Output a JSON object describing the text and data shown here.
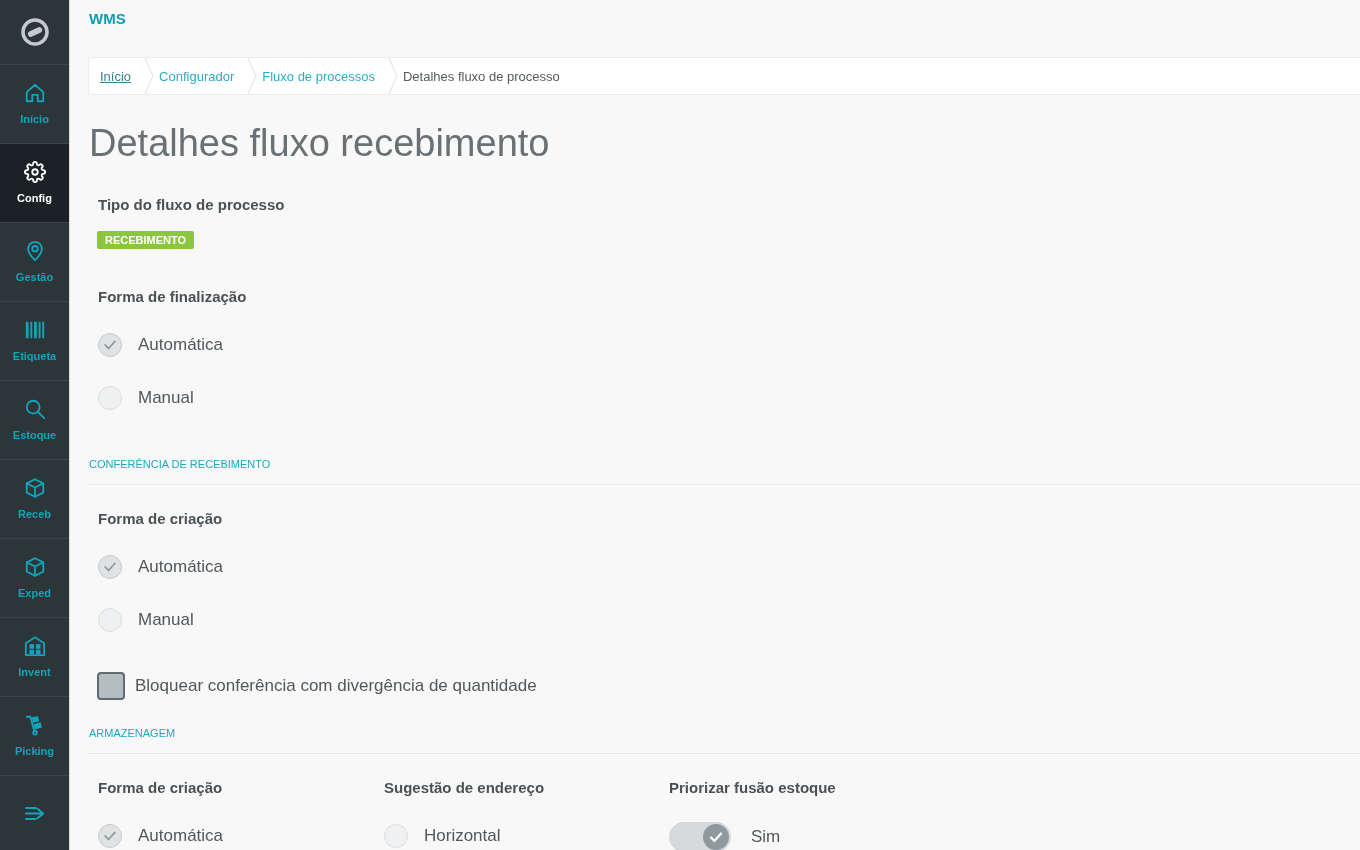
{
  "app": {
    "title": "WMS"
  },
  "sidebar": {
    "items": [
      {
        "label": "Início",
        "selected": false
      },
      {
        "label": "Config",
        "selected": true
      },
      {
        "label": "Gestão",
        "selected": false
      },
      {
        "label": "Etiqueta",
        "selected": false
      },
      {
        "label": "Estoque",
        "selected": false
      },
      {
        "label": "Receb",
        "selected": false
      },
      {
        "label": "Exped",
        "selected": false
      },
      {
        "label": "Invent",
        "selected": false
      },
      {
        "label": "Picking",
        "selected": false
      }
    ]
  },
  "breadcrumb": [
    {
      "kind": "link",
      "label": "Início",
      "underlined": true
    },
    {
      "kind": "link",
      "label": "Configurador",
      "underlined": false
    },
    {
      "kind": "link",
      "label": "Fluxo de processos",
      "underlined": false
    },
    {
      "kind": "current",
      "label": "Detalhes fluxo de processo"
    }
  ],
  "page_title": "Detalhes fluxo recebimento",
  "form": {
    "groups": [
      {
        "kind": "tag",
        "label": "Tipo do fluxo de processo",
        "value": "RECEBIMENTO"
      },
      {
        "kind": "radio",
        "label": "Forma de finalização",
        "disabled": true,
        "options": [
          {
            "label": "Automática",
            "selected": true
          },
          {
            "label": "Manual",
            "selected": false
          }
        ]
      }
    ]
  },
  "sections": [
    {
      "title": "CONFERÊNCIA DE RECEBIMENTO",
      "columns": false,
      "fields": [
        {
          "kind": "radio",
          "label": "Forma de criação",
          "disabled": true,
          "options": [
            {
              "label": "Automática",
              "selected": true
            },
            {
              "label": "Manual",
              "selected": false
            }
          ]
        },
        {
          "kind": "checkbox",
          "label": "Bloquear conferência com divergência de quantidade",
          "checked": false,
          "disabled": true
        }
      ]
    },
    {
      "title": "ARMAZENAGEM",
      "columns": true,
      "fields": [
        {
          "kind": "radio",
          "label": "Forma de criação",
          "disabled": true,
          "options": [
            {
              "label": "Automática",
              "selected": true
            }
          ]
        },
        {
          "kind": "radio",
          "label": "Sugestão de endereço",
          "disabled": true,
          "options": [
            {
              "label": "Horizontal",
              "selected": false
            }
          ]
        },
        {
          "kind": "toggle",
          "label": "Priorizar fusão estoque",
          "on": true,
          "disabled": true,
          "value_label": "Sim"
        }
      ]
    }
  ]
}
